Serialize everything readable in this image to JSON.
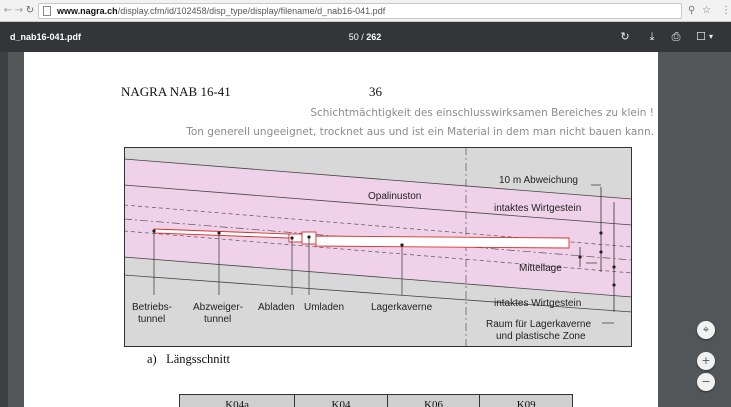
{
  "browser": {
    "back_icon": "back-arrow-icon",
    "forward_icon": "forward-arrow-icon",
    "reload_icon": "reload-icon",
    "url_host": "www.nagra.ch",
    "url_path": "/display.cfm/id/102458/disp_type/display/filename/d_nab16-041.pdf",
    "zoom_icon": "zoom-icon",
    "bookmark_icon": "star-icon"
  },
  "toolbar": {
    "filename": "d_nab16-041.pdf",
    "current_page": "50",
    "separator": "/",
    "total_pages": "262",
    "rotate_icon": "rotate-icon",
    "download_icon": "download-icon",
    "print_icon": "print-icon",
    "bookmark_icon": "bookmark-icon",
    "dropdown_icon": "chevron-down-icon"
  },
  "page": {
    "header_left": "NAGRA NAB 16-41",
    "page_number": "36",
    "note_line1": "Schichtmächtigkeit des einschlusswirksamen Bereiches zu klein !",
    "note_line2": "Ton generell ungeeignet, trocknet aus und ist ein Material in dem man nicht bauen kann.",
    "caption": "a)   Längsschnitt",
    "table_headers": [
      "K04a",
      "K04",
      "K06",
      "K09"
    ]
  },
  "diagram": {
    "label_opalinuston": "Opalinuston",
    "label_abweichung": "10 m Abweichung",
    "label_intakt_top": "intaktes Wirtgestein",
    "label_mittellage": "Mittellage",
    "label_intakt_bottom": "intaktes Wirtgestein",
    "label_raum_1": "Raum für Lagerkaverne",
    "label_raum_2": "und plastische Zone",
    "label_betriebs_1": "Betriebs-",
    "label_betriebs_2": "tunnel",
    "label_abzweiger_1": "Abzweiger-",
    "label_abzweiger_2": "tunnel",
    "label_abladen": "Abladen",
    "label_umladen": "Umladen",
    "label_lagerkaverne": "Lagerkaverne",
    "colors": {
      "rock": "#d8d8d8",
      "clay": "#efd2ea",
      "tunnel_outline": "#d9302c"
    }
  },
  "controls": {
    "fit_icon": "fit-page-icon",
    "zoom_in_icon": "zoom-in-icon",
    "zoom_out_icon": "zoom-out-icon"
  }
}
